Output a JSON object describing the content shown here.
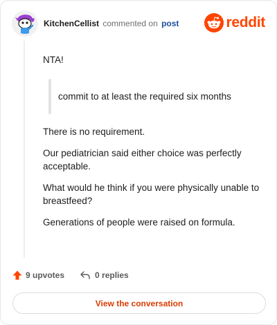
{
  "comment": {
    "username": "KitchenCellist",
    "action_text": "commented on",
    "post_link": "post",
    "paragraphs": {
      "p1": "NTA!",
      "quote": "commit to at least the required six months",
      "p2": "There is no requirement.",
      "p3": "Our pediatrician said either choice was perfectly acceptable.",
      "p4": "What would he think if you were physically unable to breastfeed?",
      "p5": "Generations of people were raised on formula."
    }
  },
  "brand": {
    "wordmark": "reddit",
    "icon": "reddit-alien-logo",
    "color": "#ff4500"
  },
  "footer": {
    "upvotes": "9 upvotes",
    "upvote_icon": "arrow-up-icon",
    "upvote_color": "#ff4500",
    "replies": "0 replies",
    "reply_icon": "reply-arrow-icon"
  },
  "cta": {
    "label": "View the conversation",
    "color": "#d93a00"
  },
  "avatar": {
    "icon": "snoo-avatar-purple-hair"
  }
}
